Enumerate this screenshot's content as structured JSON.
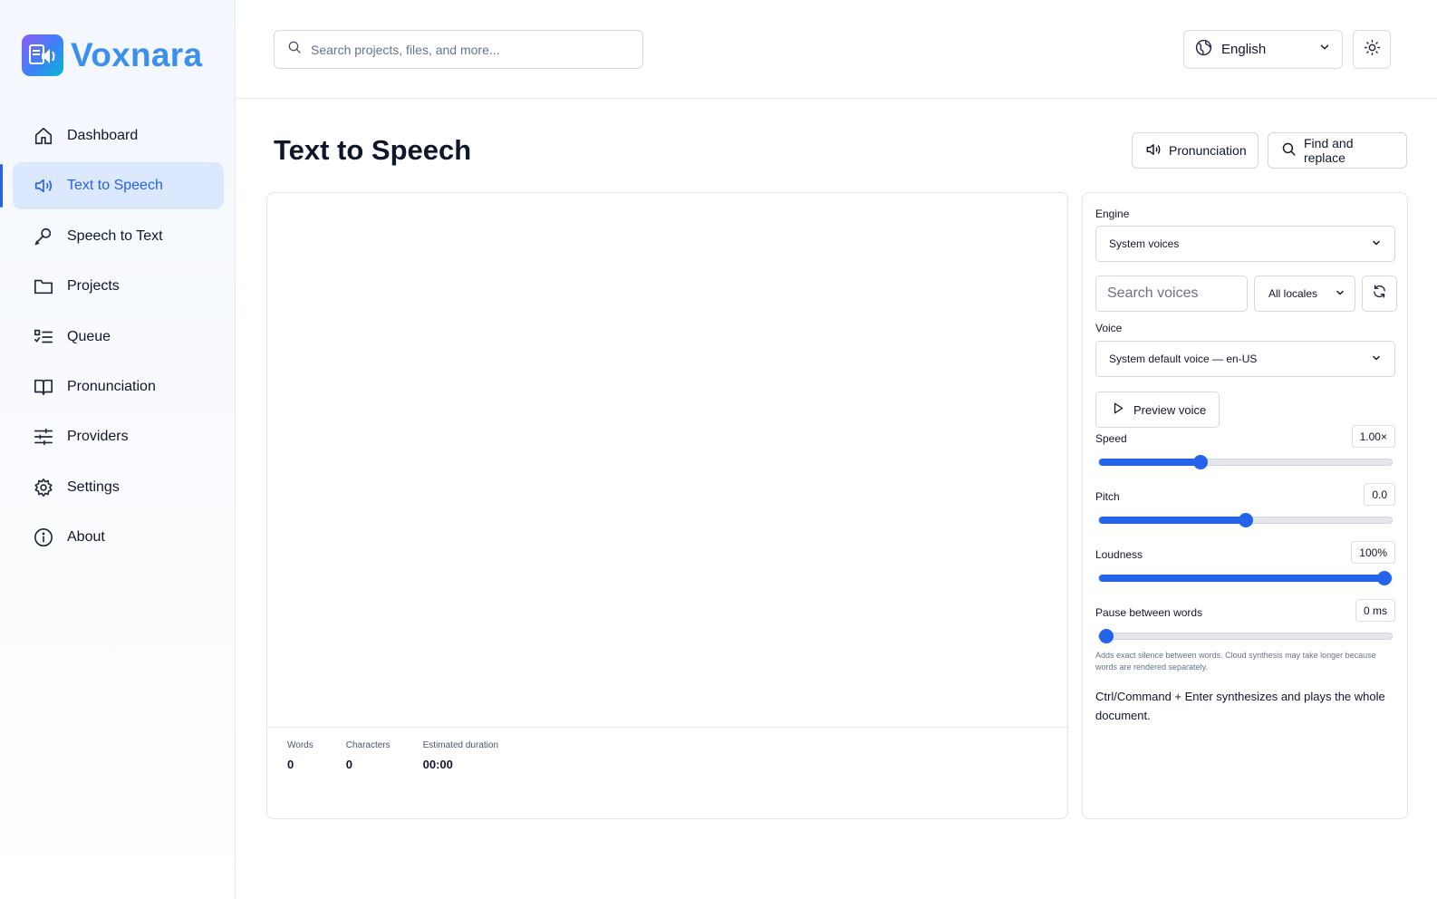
{
  "brand": {
    "name": "Voxnara"
  },
  "sidebar": {
    "items": [
      {
        "label": "Dashboard",
        "icon": "home-icon",
        "active": false
      },
      {
        "label": "Text to Speech",
        "icon": "speaker-icon",
        "active": true
      },
      {
        "label": "Speech to Text",
        "icon": "microphone-icon",
        "active": false
      },
      {
        "label": "Projects",
        "icon": "folder-icon",
        "active": false
      },
      {
        "label": "Queue",
        "icon": "list-check-icon",
        "active": false
      },
      {
        "label": "Pronunciation",
        "icon": "book-icon",
        "active": false
      },
      {
        "label": "Providers",
        "icon": "sliders-icon",
        "active": false
      },
      {
        "label": "Settings",
        "icon": "gear-icon",
        "active": false
      },
      {
        "label": "About",
        "icon": "info-icon",
        "active": false
      }
    ]
  },
  "topbar": {
    "search_placeholder": "Search projects, files, and more...",
    "language": "English"
  },
  "page": {
    "title": "Text to Speech",
    "pronunciation_button": "Pronunciation",
    "find_replace_button": "Find and replace"
  },
  "editor": {
    "stats": [
      {
        "label": "Words",
        "value": "0"
      },
      {
        "label": "Characters",
        "value": "0"
      },
      {
        "label": "Estimated duration",
        "value": "00:00"
      }
    ]
  },
  "panel": {
    "engine_label": "Engine",
    "engine_value": "System voices",
    "voice_search_placeholder": "Search voices",
    "locale_value": "All locales",
    "voice_label": "Voice",
    "voice_value": "System default voice — en-US",
    "preview_button": "Preview voice",
    "sliders": [
      {
        "label": "Speed",
        "display": "1.00×",
        "fraction": 0.34
      },
      {
        "label": "Pitch",
        "display": "0.0",
        "fraction": 0.5
      },
      {
        "label": "Loudness",
        "display": "100%",
        "fraction": 1.0
      },
      {
        "label": "Pause between words",
        "display": "0 ms",
        "fraction": 0.0
      }
    ],
    "hint": "Adds exact silence between words. Cloud synthesis may take longer because words are rendered separately.",
    "shortcut": "Ctrl/Command + Enter synthesizes and plays the whole document."
  },
  "colors": {
    "accent": "#2563eb",
    "brand_text": "#3b8ff0",
    "active_bg": "#dbe8fd"
  }
}
